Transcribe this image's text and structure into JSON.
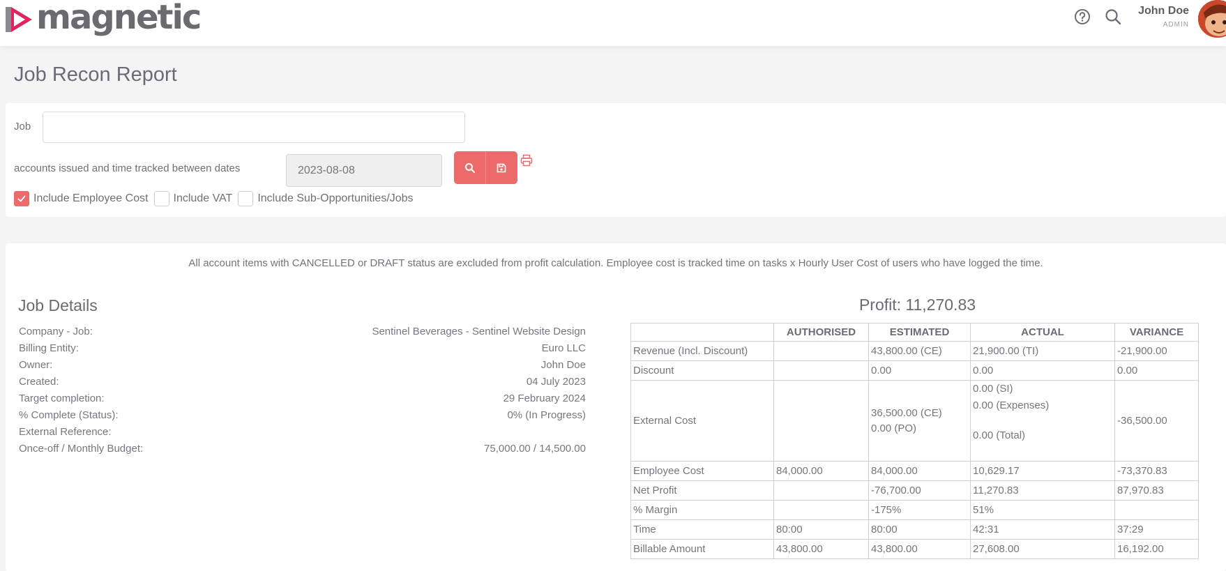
{
  "header": {
    "brand": "magnetic",
    "user_name": "John Doe",
    "user_role": "ADMIN",
    "icons": [
      "help-icon",
      "search-icon"
    ]
  },
  "page": {
    "title": "Job Recon Report"
  },
  "filters": {
    "job_label": "Job",
    "job_value": "",
    "dates_label": "accounts issued and time tracked between dates",
    "date_value": "2023-08-08",
    "checkboxes": [
      {
        "label": "Include Employee Cost",
        "checked": true
      },
      {
        "label": "Include VAT",
        "checked": false
      },
      {
        "label": "Include Sub-Opportunities/Jobs",
        "checked": false
      }
    ]
  },
  "notice": "All account items with CANCELLED or DRAFT status are excluded from profit calculation. Employee cost is tracked time on tasks x Hourly User Cost of users who have logged the time.",
  "job_details": {
    "title": "Job Details",
    "rows": [
      {
        "label": "Company - Job:",
        "value": "Sentinel Beverages - Sentinel Website Design"
      },
      {
        "label": "Billing Entity:",
        "value": "Euro LLC"
      },
      {
        "label": "Owner:",
        "value": "John Doe"
      },
      {
        "label": "Created:",
        "value": "04 July 2023"
      },
      {
        "label": "Target completion:",
        "value": "29 February 2024"
      },
      {
        "label": "% Complete (Status):",
        "value": "0% (In Progress)"
      },
      {
        "label": "External Reference:",
        "value": ""
      },
      {
        "label": "Once-off / Monthly Budget:",
        "value": "75,000.00 / 14,500.00"
      }
    ]
  },
  "profit": {
    "text": "Profit: 11,270.83"
  },
  "recon_table": {
    "headers": [
      "",
      "AUTHORISED",
      "ESTIMATED",
      "ACTUAL",
      "VARIANCE"
    ],
    "revenue": [
      "Revenue (Incl. Discount)",
      "",
      "43,800.00 (CE)",
      "21,900.00 (TI)",
      "-21,900.00"
    ],
    "discount": [
      "Discount",
      "",
      "0.00",
      "0.00",
      "0.00"
    ],
    "external_cost": {
      "label": "External Cost",
      "authorised": "",
      "estimated": [
        "36,500.00 (CE)",
        "0.00 (PO)"
      ],
      "actual": [
        "0.00 (SI)",
        "0.00 (Expenses)",
        "0.00 (Total)"
      ],
      "variance": "-36,500.00"
    },
    "employee_cost": [
      "Employee Cost",
      "84,000.00",
      "84,000.00",
      "10,629.17",
      "-73,370.83"
    ],
    "net_profit": [
      "Net Profit",
      "",
      "-76,700.00",
      "11,270.83",
      "87,970.83"
    ],
    "margin": [
      "% Margin",
      "",
      "-175%",
      "51%",
      ""
    ],
    "time": [
      "Time",
      "80:00",
      "80:00",
      "42:31",
      "37:29"
    ],
    "billable": [
      "Billable Amount",
      "43,800.00",
      "43,800.00",
      "27,608.00",
      "16,192.00"
    ]
  },
  "colors": {
    "accent": "#ec6a6a",
    "brand_magenta": "#e0245e",
    "text": "#6b6a75"
  }
}
